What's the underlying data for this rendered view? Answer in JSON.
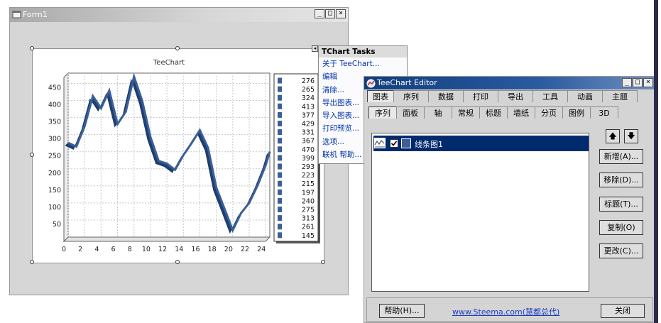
{
  "form1": {
    "title": "Form1",
    "caps": [
      "_",
      "□",
      "×"
    ]
  },
  "tasks": {
    "title": "TChart Tasks",
    "items": [
      "关于 TeeChart...",
      "编辑",
      "清除...",
      "导出图表...",
      "导入图表...",
      "打印预览...",
      "选项...",
      "联机 帮助..."
    ]
  },
  "editor": {
    "title": "TeeChart Editor",
    "caps": [
      "_",
      "□",
      "×"
    ],
    "top_tabs": [
      "图表",
      "序列",
      "数据",
      "打印",
      "导出",
      "工具",
      "动画",
      "主题"
    ],
    "sub_tabs": [
      "序列",
      "面板",
      "轴",
      "常规",
      "标题",
      "墙纸",
      "分页",
      "图例",
      "3D"
    ],
    "series_name": "线条图1",
    "side_buttons": [
      "新增(A)...",
      "移除(D)...",
      "标题(T)...",
      "复制(O)",
      "更改(C)..."
    ],
    "help_button": "帮助(H)...",
    "link": "www.Steema.com(慧都总代)",
    "close_button": "关闭",
    "accent": "#002a6e"
  },
  "chart_data": {
    "type": "line",
    "title": "TeeChart",
    "x": [
      0,
      1,
      2,
      3,
      4,
      5,
      6,
      7,
      8,
      9,
      10,
      11,
      12,
      13,
      14,
      15,
      16,
      17,
      18,
      19,
      20,
      21,
      22,
      23,
      24,
      25
    ],
    "values": [
      276,
      265,
      324,
      413,
      377,
      429,
      331,
      367,
      470,
      399,
      293,
      223,
      215,
      197,
      240,
      275,
      313,
      261,
      145,
      83,
      20,
      70,
      100,
      150,
      210,
      250
    ],
    "legend_values": [
      276,
      265,
      324,
      413,
      377,
      429,
      331,
      367,
      470,
      399,
      293,
      223,
      215,
      197,
      240,
      275,
      313,
      261,
      145
    ],
    "xticks": [
      0,
      2,
      4,
      6,
      8,
      10,
      12,
      14,
      16,
      18,
      20,
      22,
      24
    ],
    "yticks": [
      50,
      100,
      150,
      200,
      250,
      300,
      350,
      400,
      450
    ],
    "xlim": [
      0,
      24.5
    ],
    "ylim": [
      0,
      480
    ],
    "grid": true,
    "legend_position": "right",
    "series_color": "#3b5f97"
  }
}
